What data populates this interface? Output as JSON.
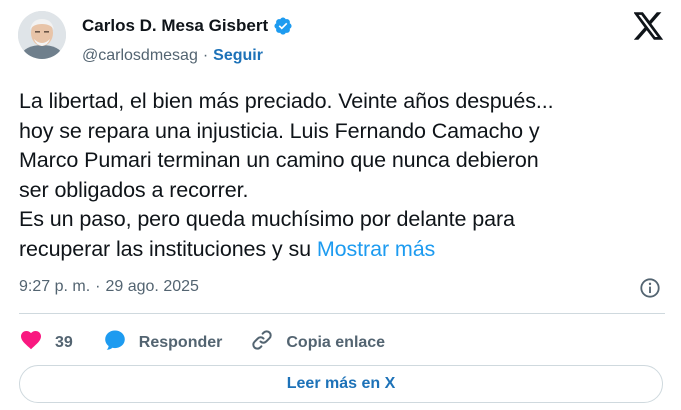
{
  "author": {
    "display_name": "Carlos D. Mesa Gisbert",
    "handle": "@carlosdmesag",
    "separator": "·",
    "follow_label": "Seguir"
  },
  "tweet": {
    "lines": [
      "La libertad, el bien más preciado. Veinte años después...",
      "hoy se repara una injusticia. Luis Fernando Camacho y",
      "Marco Pumari terminan un camino que nunca debieron",
      "ser obligados a recorrer.",
      "Es un paso, pero queda muchísimo por delante para",
      "recuperar las instituciones y su"
    ],
    "show_more_label": "Mostrar más"
  },
  "meta": {
    "time": "9:27 p. m.",
    "separator": "·",
    "date": "29 ago. 2025"
  },
  "actions": {
    "like_count": "39",
    "reply_label": "Responder",
    "copy_link_label": "Copia enlace"
  },
  "footer": {
    "read_more_label": "Leer más en X"
  },
  "colors": {
    "link_blue": "#1d72b8",
    "accent_blue": "#1d9bf0",
    "like_pink": "#f91880",
    "verified_blue": "#1d9bf0",
    "muted_gray": "#536471"
  },
  "icons": [
    "avatar",
    "verified-badge-icon",
    "x-logo-icon",
    "info-icon",
    "heart-icon",
    "reply-bubble-icon",
    "link-icon"
  ]
}
